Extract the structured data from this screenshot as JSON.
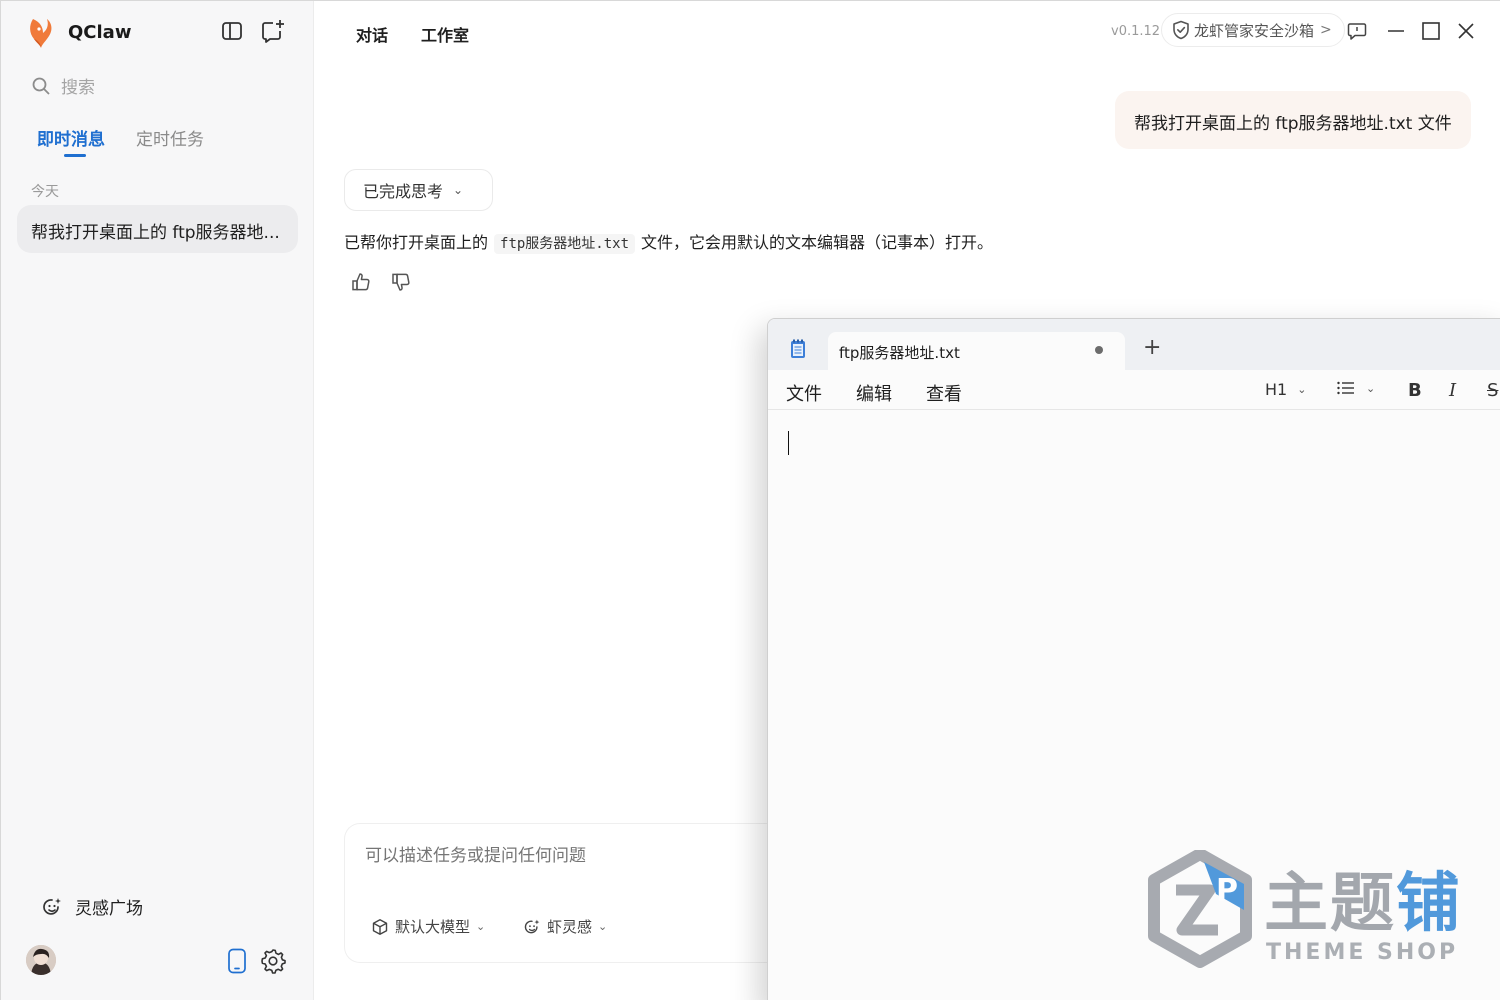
{
  "app": {
    "name": "QClaw"
  },
  "sidebar": {
    "search_placeholder": "搜索",
    "tabs": [
      {
        "label": "即时消息",
        "active": true
      },
      {
        "label": "定时任务",
        "active": false
      }
    ],
    "date_group": "今天",
    "conversations": [
      {
        "title": "帮我打开桌面上的 ftp服务器地..."
      }
    ],
    "inspiration_label": "灵感广场"
  },
  "header": {
    "tabs": [
      {
        "label": "对话"
      },
      {
        "label": "工作室"
      }
    ],
    "version": "v0.1.12",
    "sandbox_label": "龙虾管家安全沙箱",
    "sandbox_arrow": ">"
  },
  "chat": {
    "user_message": "帮我打开桌面上的 ftp服务器地址.txt 文件",
    "thinking_label": "已完成思考",
    "reply_prefix": "已帮你打开桌面上的",
    "reply_code": "ftp服务器地址.txt",
    "reply_suffix": "文件，它会用默认的文本编辑器（记事本）打开。"
  },
  "composer": {
    "placeholder": "可以描述任务或提问任何问题",
    "model_label": "默认大模型",
    "skill_label": "虾灵感"
  },
  "notepad": {
    "tab_title": "ftp服务器地址.txt",
    "new_tab_symbol": "+",
    "menus": [
      "文件",
      "编辑",
      "查看"
    ],
    "heading_label": "H1",
    "bold_label": "B",
    "italic_label": "I",
    "strike_label": "S"
  },
  "watermark": {
    "cn_1": "主",
    "cn_2": "题",
    "cn_3": "铺",
    "en": "THEME SHOP"
  },
  "colors": {
    "accent": "#1f6fd0",
    "user_bubble": "#fbf4f0",
    "sidebar_bg": "#f7f7f8"
  }
}
